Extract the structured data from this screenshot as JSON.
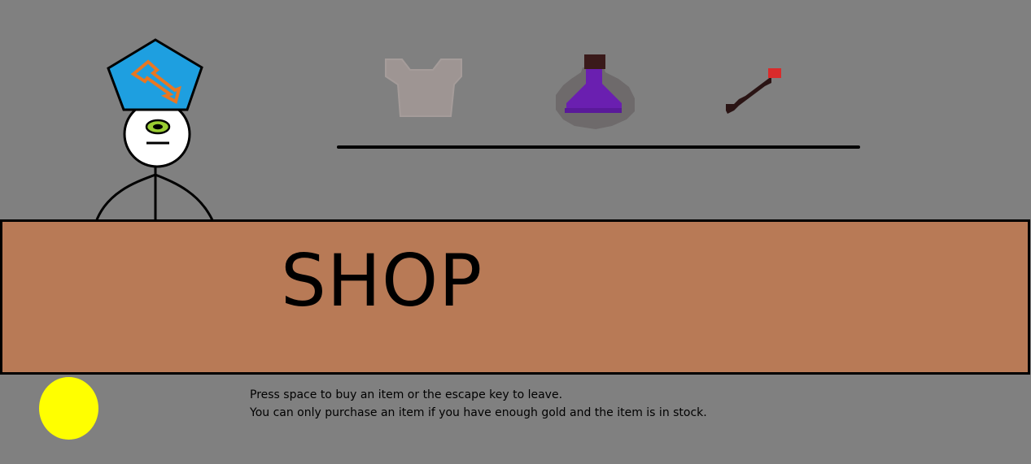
{
  "scene": {
    "background_color": "#808080",
    "counter_color": "#b87a56"
  },
  "shop": {
    "title": "SHOP"
  },
  "instructions": {
    "line1": "Press space to buy an item or the escape key to leave.",
    "line2": "You can only purchase an item if you have enough gold and the item is in stock."
  },
  "shopkeeper": {
    "hat_color": "#1e9fe0",
    "emblem_color": "#e87722",
    "eye_color": "#9acd32"
  },
  "items": [
    {
      "name": "armor-icon",
      "color": "#9e9593"
    },
    {
      "name": "potion-icon",
      "color": "#6a1fb0"
    },
    {
      "name": "wand-icon",
      "color": "#2a1414"
    }
  ],
  "gold": {
    "icon": "gold-coin-icon",
    "color": "#ffff00"
  }
}
